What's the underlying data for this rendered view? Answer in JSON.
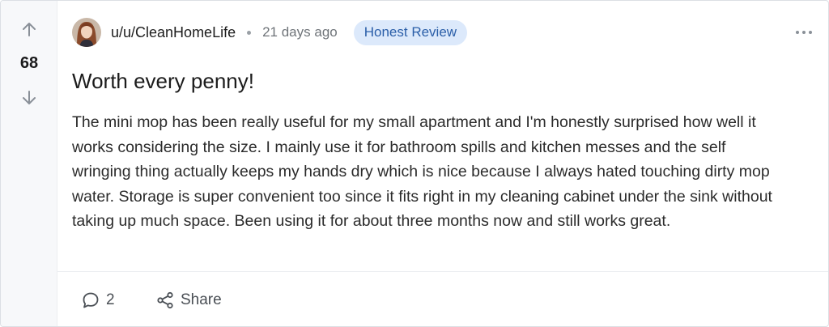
{
  "vote": {
    "score": "68"
  },
  "post": {
    "author": "u/u/CleanHomeLife",
    "timestamp": "21 days ago",
    "flair": "Honest Review",
    "title": "Worth every penny!",
    "body": "The mini mop has been really useful for my small apartment and I'm honestly surprised how well it works considering the size. I mainly use it for bathroom spills and kitchen messes and the self wringing thing actually keeps my hands dry which is nice because I always hated touching dirty mop water. Storage is super convenient too since it fits right in my cleaning cabinet under the sink without taking up much space. Been using it for about three months now and still works great."
  },
  "actions": {
    "comments_count": "2",
    "share_label": "Share"
  },
  "colors": {
    "flair_bg": "#dce9fb",
    "flair_text": "#2a5ea8",
    "vote_column_bg": "#f7f8fa"
  },
  "icons": {
    "upvote": "arrow-up-icon",
    "downvote": "arrow-down-icon",
    "more": "more-horizontal-icon",
    "comment": "comment-bubble-icon",
    "share": "share-icon"
  }
}
